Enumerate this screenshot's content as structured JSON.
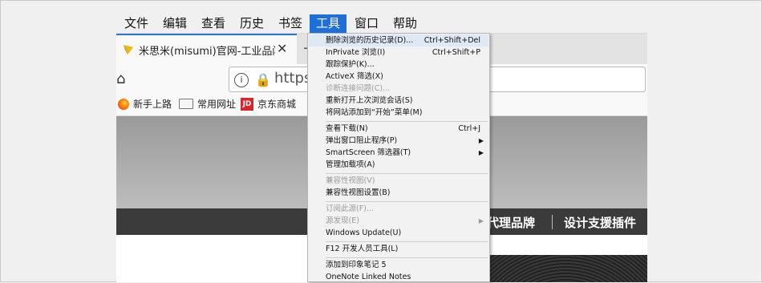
{
  "menubar": [
    "文件",
    "编辑",
    "查看",
    "历史",
    "书签",
    "工具",
    "窗口",
    "帮助"
  ],
  "tab": {
    "title": "米思米(misumi)官网-工业品闪购",
    "close": "✕",
    "newtab": "+"
  },
  "nav": {
    "home_glyph": "⌂",
    "info": "i",
    "lock": "🔒",
    "url": "https:/"
  },
  "bookmarks": [
    "新手上路",
    "常用网址",
    "京东商城"
  ],
  "jd_badge": "JD",
  "site_nav": [
    "代理品牌",
    "设计支援插件"
  ],
  "dropdown": [
    {
      "label": "删除浏览的历史记录(D)...",
      "shortcut": "Ctrl+Shift+Del",
      "hl": true
    },
    {
      "label": "InPrivate 浏览(I)",
      "shortcut": "Ctrl+Shift+P"
    },
    {
      "label": "跟踪保护(K)..."
    },
    {
      "label": "ActiveX 筛选(X)"
    },
    {
      "label": "诊断连接问题(C)...",
      "disabled": true
    },
    {
      "label": "重新打开上次浏览会话(S)"
    },
    {
      "label": "将网站添加到“开始”菜单(M)"
    },
    {
      "label": "查看下载(N)",
      "shortcut": "Ctrl+J"
    },
    {
      "label": "弹出窗口阻止程序(P)",
      "arrow": "▶"
    },
    {
      "label": "SmartScreen 筛选器(T)",
      "arrow": "▶"
    },
    {
      "label": "管理加载项(A)"
    },
    {
      "label": "兼容性视图(V)",
      "disabled": true
    },
    {
      "label": "兼容性视图设置(B)"
    },
    {
      "label": "订阅此源(F)...",
      "disabled": true
    },
    {
      "label": "源发现(E)",
      "disabled": true,
      "arrow": "▶"
    },
    {
      "label": "Windows Update(U)"
    },
    {
      "label": "F12 开发人员工具(L)"
    },
    {
      "label": "添加到印象笔记 5"
    },
    {
      "label": "OneNote Linked Notes"
    }
  ]
}
